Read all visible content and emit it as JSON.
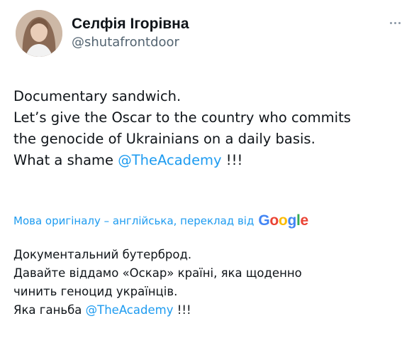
{
  "author": {
    "display_name": "Селфія Ігорівна",
    "handle": "@shutafrontdoor"
  },
  "tweet": {
    "line1": "Documentary sandwich.",
    "line2": "Let’s give the Oscar to the country who commits",
    "line3": "the genocide of Ukrainians on a daily basis.",
    "line4_prefix": "What a shame ",
    "line4_mention": "@TheAcademy",
    "line4_suffix": " !!!"
  },
  "translation": {
    "note": "Мова оригіналу – англійська, переклад від",
    "provider": "Google",
    "line1": "Документальний бутерброд.",
    "line2": "Давайте віддамо «Оскар» країні, яка щоденно",
    "line3": "чинить геноцид українців.",
    "line4_prefix": "Яка ганьба ",
    "line4_mention": "@TheAcademy",
    "line4_suffix": " !!!"
  },
  "icons": {
    "more": "more-horizontal-icon",
    "avatar": "profile-photo"
  },
  "colors": {
    "link": "#1d9bf0",
    "text": "#0f1419",
    "secondary": "#536471"
  }
}
